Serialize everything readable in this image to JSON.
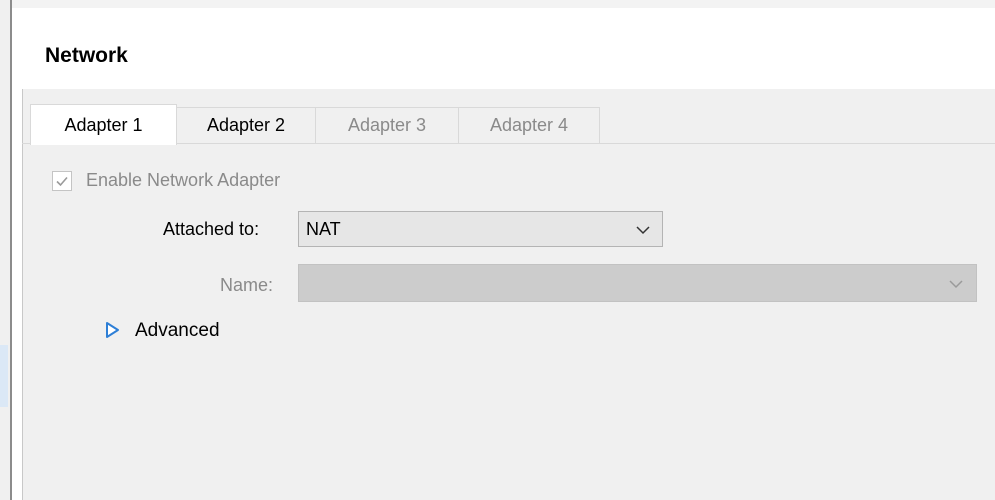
{
  "page": {
    "title": "Network"
  },
  "tabs": [
    {
      "label": "Adapter 1",
      "state": "active"
    },
    {
      "label": "Adapter 2",
      "state": "enabled"
    },
    {
      "label": "Adapter 3",
      "state": "disabled"
    },
    {
      "label": "Adapter 4",
      "state": "disabled"
    }
  ],
  "adapter": {
    "enable_label": "Enable Network Adapter",
    "enable_checked": true,
    "enable_disabled": true,
    "attached_to_label": "Attached to:",
    "attached_to_value": "NAT",
    "name_label": "Name:",
    "name_value": "",
    "name_disabled": true,
    "advanced_label": "Advanced",
    "advanced_expanded": false
  },
  "icons": {
    "checkbox": "checkmark-icon",
    "dropdown": "chevron-down-icon",
    "advanced": "triangle-right-icon"
  },
  "colors": {
    "accent": "#2e7fd6",
    "panel_background": "#f0f0f0",
    "disabled_text": "#8a8a8a",
    "disabled_field": "#cccccc"
  }
}
